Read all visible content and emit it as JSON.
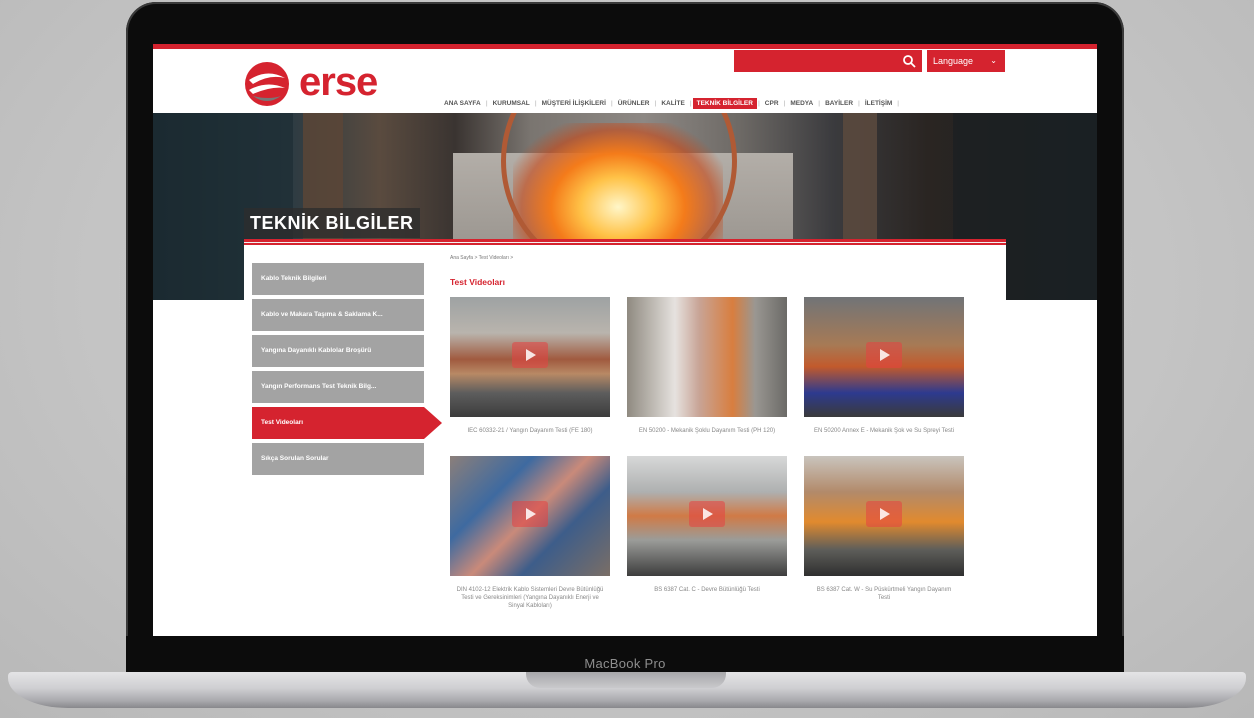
{
  "device": {
    "brand_label": "MacBook Pro"
  },
  "site": {
    "logo_text": "erse",
    "language_label": "Language",
    "nav": [
      {
        "label": "ANA SAYFA",
        "active": false
      },
      {
        "label": "KURUMSAL",
        "active": false
      },
      {
        "label": "MÜŞTERİ İLİŞKİLERİ",
        "active": false
      },
      {
        "label": "ÜRÜNLER",
        "active": false
      },
      {
        "label": "KALİTE",
        "active": false
      },
      {
        "label": "TEKNİK BİLGİLER",
        "active": true
      },
      {
        "label": "CPR",
        "active": false
      },
      {
        "label": "MEDYA",
        "active": false
      },
      {
        "label": "BAYİLER",
        "active": false
      },
      {
        "label": "İLETİŞİM",
        "active": false
      }
    ],
    "colors": {
      "brand_red": "#d5232f",
      "sidebar_gray": "#a3a3a3"
    }
  },
  "hero": {
    "title": "TEKNİK BİLGİLER"
  },
  "breadcrumb": "Ana Sayfa > Test Videoları >",
  "page_heading": "Test Videoları",
  "sidebar": [
    {
      "label": "Kablo Teknik Bilgileri",
      "active": false
    },
    {
      "label": "Kablo ve Makara Taşıma & Saklama K...",
      "active": false
    },
    {
      "label": "Yangına Dayanıklı Kablolar Broşürü",
      "active": false
    },
    {
      "label": "Yangın Performans Test Teknik Bilg...",
      "active": false
    },
    {
      "label": "Test Videoları",
      "active": true
    },
    {
      "label": "Sıkça Sorulan Sorular",
      "active": false
    }
  ],
  "videos": [
    {
      "caption": "IEC 60332-21 / Yangın Dayanım Testi (FE 180)",
      "icon": "play-icon"
    },
    {
      "caption": "EN 50200 - Mekanik Şoklu Dayanım Testi (PH 120)",
      "icon": "play-icon"
    },
    {
      "caption": "EN 50200 Annex E - Mekanik Şok ve Su Spreyi Testi",
      "icon": "play-icon"
    },
    {
      "caption": "DIN 4102-12 Elektrik Kablo Sistemleri Devre Bütünlüğü Testi ve Gereksinimleri (Yangına Dayanıklı Enerji ve Sinyal Kabloları)",
      "icon": "play-icon"
    },
    {
      "caption": "BS 6387 Cat. C - Devre Bütünlüğü Testi",
      "icon": "play-icon"
    },
    {
      "caption": "BS 6387 Cat. W - Su Püskürtmeli Yangın Dayanım Testi",
      "icon": "play-icon"
    }
  ]
}
